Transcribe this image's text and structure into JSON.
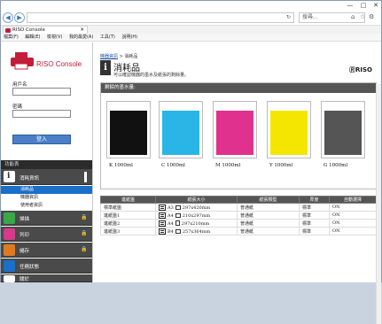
{
  "browser": {
    "window_controls": [
      "—",
      "□",
      "✕"
    ],
    "url": "",
    "search_placeholder": "搜尋...",
    "tab_title": "RISO Console",
    "menu": [
      "檔案(F)",
      "編輯(E)",
      "檢視(V)",
      "我的最愛(A)",
      "工具(T)",
      "說明(H)"
    ]
  },
  "sidebar": {
    "logo_text": "RISO Console",
    "username_label": "用戶名",
    "password_label": "密碼",
    "login_button": "登入",
    "function_header": "功能表",
    "items": [
      {
        "label": "消耗資訊",
        "color": "#333333",
        "icon": "printer-info-icon",
        "lock": false
      },
      {
        "label": "掃描",
        "color": "#3aa84a",
        "icon": "scan-icon",
        "lock": true
      },
      {
        "label": "列印",
        "color": "#d63a8a",
        "icon": "print-icon",
        "lock": true
      },
      {
        "label": "儲存",
        "color": "#e07a20",
        "icon": "storage-icon",
        "lock": true
      },
      {
        "label": "任務狀態",
        "color": "#1a6fc8",
        "icon": "job-status-icon",
        "lock": false
      },
      {
        "label": "關於",
        "color": "#555555",
        "icon": "about-icon",
        "lock": false
      }
    ],
    "sub_items": [
      "消耗品",
      "機器資訊",
      "使用者資訊"
    ]
  },
  "content": {
    "breadcrumb_link": "機器資訊",
    "breadcrumb_rest": " > 消耗品",
    "title": "消耗品",
    "subtitle": "可以確認機器的墨水及紙張的剩餘量。",
    "brand": "ⓇRISO",
    "ink_panel_title": "剩餘的墨水量:",
    "inks": [
      {
        "label": "K 1000ml",
        "color": "#111111"
      },
      {
        "label": "C 1000ml",
        "color": "#29b6e6"
      },
      {
        "label": "M 1000ml",
        "color": "#e0318f"
      },
      {
        "label": "Y 1000ml",
        "color": "#f5e600"
      },
      {
        "label": "G 1000ml",
        "color": "#555555"
      }
    ],
    "tray_headers": [
      "進紙盤",
      "紙張大小",
      "紙張類型",
      "厚度",
      "自動選擇"
    ],
    "trays": [
      {
        "name": "標準紙盤",
        "size": "A3",
        "dims": "297x420mm",
        "type": "普通紙",
        "thickness": "標準",
        "auto": "ON"
      },
      {
        "name": "進紙盤1",
        "size": "A4",
        "dims": "210x297mm",
        "type": "普通紙",
        "thickness": "標準",
        "auto": "ON"
      },
      {
        "name": "進紙盤2",
        "size": "A4",
        "dims": "297x210mm",
        "type": "普通紙",
        "thickness": "標準",
        "auto": "ON"
      },
      {
        "name": "進紙盤3",
        "size": "B4",
        "dims": "257x364mm",
        "type": "普通紙",
        "thickness": "標準",
        "auto": "ON"
      }
    ]
  }
}
